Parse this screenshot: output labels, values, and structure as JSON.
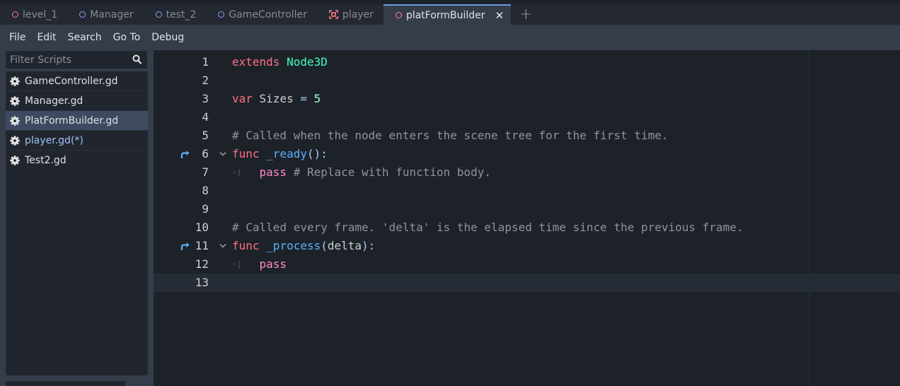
{
  "tabs": [
    {
      "label": "level_1",
      "icon": "scene-ring-icon",
      "color": "#fc7f7f"
    },
    {
      "label": "Manager",
      "icon": "scene-ring-icon",
      "color": "#8da5f3"
    },
    {
      "label": "test_2",
      "icon": "scene-ring-icon",
      "color": "#8da5f3"
    },
    {
      "label": "GameController",
      "icon": "scene-ring-icon",
      "color": "#8da5f3"
    },
    {
      "label": "player",
      "icon": "character-body-icon",
      "color": "#fc7f7f"
    },
    {
      "label": "platFormBuilder",
      "icon": "scene-ring-icon",
      "color": "#fc7f7f",
      "active": true
    }
  ],
  "tab_add_label": "+",
  "menu": [
    "File",
    "Edit",
    "Search",
    "Go To",
    "Debug"
  ],
  "filter": {
    "placeholder": "Filter Scripts"
  },
  "scripts": [
    {
      "name": "GameController.gd"
    },
    {
      "name": "Manager.gd"
    },
    {
      "name": "PlatFormBuilder.gd",
      "selected": true
    },
    {
      "name": "player.gd(*)",
      "modified": true
    },
    {
      "name": "Test2.gd"
    }
  ],
  "code_lines": [
    {
      "n": "1",
      "tokens": [
        [
          "kw",
          "extends"
        ],
        [
          "plain",
          " "
        ],
        [
          "type",
          "Node3D"
        ]
      ]
    },
    {
      "n": "2",
      "tokens": []
    },
    {
      "n": "3",
      "tokens": [
        [
          "kw",
          "var"
        ],
        [
          "plain",
          " Sizes "
        ],
        [
          "sym",
          "="
        ],
        [
          "plain",
          " "
        ],
        [
          "num",
          "5"
        ]
      ]
    },
    {
      "n": "4",
      "tokens": []
    },
    {
      "n": "5",
      "tokens": [
        [
          "cmt",
          "# Called when the node enters the scene tree for the first time."
        ]
      ]
    },
    {
      "n": "6",
      "tokens": [
        [
          "kw",
          "func"
        ],
        [
          "plain",
          " "
        ],
        [
          "fn",
          "_ready"
        ],
        [
          "sym",
          "():"
        ]
      ],
      "override": true,
      "fold": true
    },
    {
      "n": "7",
      "tokens": [
        [
          "plain",
          "    "
        ],
        [
          "pass",
          "pass"
        ],
        [
          "plain",
          " "
        ],
        [
          "cmt",
          "# Replace with function body."
        ]
      ],
      "indent_mark": true
    },
    {
      "n": "8",
      "tokens": []
    },
    {
      "n": "9",
      "tokens": []
    },
    {
      "n": "10",
      "tokens": [
        [
          "cmt",
          "# Called every frame. 'delta' is the elapsed time since the previous frame."
        ]
      ]
    },
    {
      "n": "11",
      "tokens": [
        [
          "kw",
          "func"
        ],
        [
          "plain",
          " "
        ],
        [
          "fn",
          "_process"
        ],
        [
          "sym",
          "("
        ],
        [
          "plain",
          "delta"
        ],
        [
          "sym",
          "):"
        ]
      ],
      "override": true,
      "fold": true
    },
    {
      "n": "12",
      "tokens": [
        [
          "plain",
          "    "
        ],
        [
          "pass",
          "pass"
        ]
      ],
      "indent_mark": true
    },
    {
      "n": "13",
      "tokens": [],
      "current": true
    }
  ]
}
